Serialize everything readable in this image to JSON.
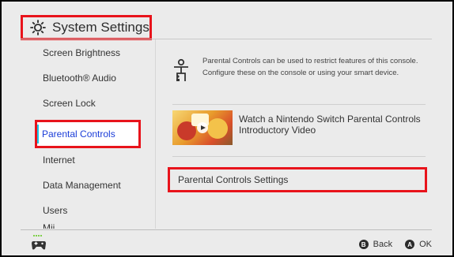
{
  "header": {
    "title": "System Settings",
    "icon": "gear-icon"
  },
  "sidebar": {
    "items": [
      {
        "label": "Screen Brightness"
      },
      {
        "label": "Bluetooth® Audio"
      },
      {
        "label": "Screen Lock"
      },
      {
        "label": "Parental Controls",
        "selected": true
      },
      {
        "label": "Internet"
      },
      {
        "label": "Data Management"
      },
      {
        "label": "Users"
      },
      {
        "label": "Mii"
      }
    ]
  },
  "content": {
    "info_text": "Parental Controls can be used to restrict features of this console. Configure these on the console or using your smart device.",
    "video_title": "Watch a Nintendo Switch Parental Controls Introductory Video",
    "settings_button": "Parental Controls Settings"
  },
  "footer": {
    "back_glyph": "B",
    "back_label": "Back",
    "ok_glyph": "A",
    "ok_label": "OK"
  },
  "colors": {
    "highlight": "#e8131b",
    "selected_text": "#1a3cd8",
    "selected_bar": "#18c8e8",
    "background": "#ebebeb"
  }
}
